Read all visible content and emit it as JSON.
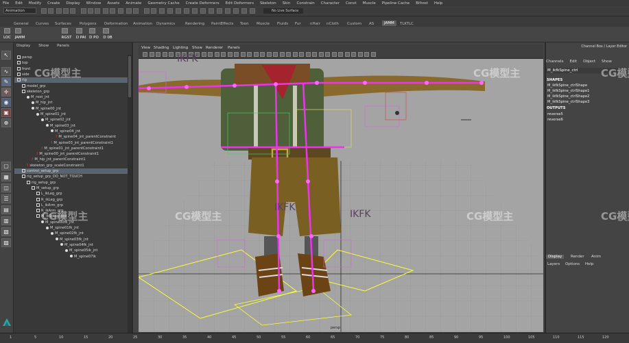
{
  "menubar": [
    "File",
    "Edit",
    "Modify",
    "Create",
    "Display",
    "Window",
    "Assets",
    "Animate",
    "Geometry Cache",
    "Create Deformers",
    "Edit Deformers",
    "Skeleton",
    "Skin",
    "Constrain",
    "Character",
    "Const",
    "Muscle",
    "Pipeline Cache",
    "Bifrost",
    "Help"
  ],
  "status": {
    "mode": "Animation",
    "live_field": "No Live Surface"
  },
  "shelf_tabs": [
    "General",
    "Curves",
    "Surfaces",
    "Polygons",
    "Deformation",
    "Animation",
    "Dynamics",
    "Rendering",
    "PaintEffects",
    "Toon",
    "Muscle",
    "Fluids",
    "Fur",
    "nHair",
    "nCloth",
    "Custom",
    "AS",
    "JAMM",
    "TLKTLC"
  ],
  "shelf_active": "JAMM",
  "shelf_buttons": [
    "LOC",
    "JAMM",
    "RGST",
    "D PAI",
    "D PO",
    "D 0B"
  ],
  "outliner": {
    "menu": [
      "Display",
      "Show",
      "Panels"
    ],
    "rows": [
      {
        "label": "persp",
        "indent": 0,
        "type": "none"
      },
      {
        "label": "top",
        "indent": 0,
        "type": "none"
      },
      {
        "label": "front",
        "indent": 0,
        "type": "none"
      },
      {
        "label": "side",
        "indent": 0,
        "type": "none"
      },
      {
        "label": "rig",
        "indent": 0,
        "type": "grp",
        "sel": true
      },
      {
        "label": "model_grp",
        "indent": 1,
        "type": "grp"
      },
      {
        "label": "skeleton_grp",
        "indent": 1,
        "type": "grp"
      },
      {
        "label": "M_root_jnt",
        "indent": 2,
        "type": "jnt"
      },
      {
        "label": "M_hip_jnt",
        "indent": 3,
        "type": "jnt"
      },
      {
        "label": "M_spine00_jnt",
        "indent": 3,
        "type": "jnt"
      },
      {
        "label": "M_spine01_jnt",
        "indent": 4,
        "type": "jnt"
      },
      {
        "label": "M_spine02_jnt",
        "indent": 5,
        "type": "jnt"
      },
      {
        "label": "M_spine03_jnt",
        "indent": 6,
        "type": "jnt"
      },
      {
        "label": "M_spine04_jnt",
        "indent": 7,
        "type": "jnt"
      },
      {
        "label": "M_spine04_jnt_parentConstraint",
        "indent": 8,
        "type": "con"
      },
      {
        "label": "M_spine03_jnt_parentConstraint1",
        "indent": 7,
        "type": "con"
      },
      {
        "label": "M_spine01_jnt_parentConstraint1",
        "indent": 5,
        "type": "con"
      },
      {
        "label": "M_spine00_jnt_parentConstraint1",
        "indent": 4,
        "type": "con"
      },
      {
        "label": "M_hip_jnt_parentConstraint1",
        "indent": 3,
        "type": "con"
      },
      {
        "label": "skeleton_grp_scaleConstraint1",
        "indent": 2,
        "type": "con"
      },
      {
        "label": "control_setup_grp",
        "indent": 1,
        "type": "grp",
        "sel": true
      },
      {
        "label": "rig_setup_grp_DO_NOT_TOUCH",
        "indent": 1,
        "type": "grp"
      },
      {
        "label": "rig_setup_grp",
        "indent": 2,
        "type": "grp"
      },
      {
        "label": "M_setup_grp",
        "indent": 3,
        "type": "grp"
      },
      {
        "label": "L_ikLeg_grp",
        "indent": 4,
        "type": "grp"
      },
      {
        "label": "R_ikLeg_grp",
        "indent": 4,
        "type": "grp"
      },
      {
        "label": "L_ikArm_grp",
        "indent": 4,
        "type": "grp"
      },
      {
        "label": "R_ikArm_grp",
        "indent": 4,
        "type": "grp"
      },
      {
        "label": "M_ikSpine_grp",
        "indent": 4,
        "type": "grp"
      },
      {
        "label": "M_spine00fk_jnt",
        "indent": 5,
        "type": "jnt"
      },
      {
        "label": "M_spine01fk_jnt",
        "indent": 6,
        "type": "jnt"
      },
      {
        "label": "M_spine02fk_jnt",
        "indent": 7,
        "type": "jnt"
      },
      {
        "label": "M_spine03fk_jnt",
        "indent": 8,
        "type": "jnt"
      },
      {
        "label": "M_spine04fk_jnt",
        "indent": 9,
        "type": "jnt"
      },
      {
        "label": "M_spine05ik_jnt",
        "indent": 10,
        "type": "jnt"
      },
      {
        "label": "M_spine07ik",
        "indent": 11,
        "type": "jnt"
      }
    ]
  },
  "viewport": {
    "menu": [
      "View",
      "Shading",
      "Lighting",
      "Show",
      "Renderer",
      "Panels"
    ],
    "labels": [
      "IKFK",
      "IKFK",
      "IKFK"
    ],
    "camera": "persp"
  },
  "channel_box": {
    "header": "Channel Box / Layer Editor",
    "menu": [
      "Channels",
      "Edit",
      "Object",
      "Show"
    ],
    "node": "M_ikfkSpine_ctrl",
    "shapes_title": "SHAPES",
    "shapes": [
      "M_ikfkSpine_ctrlShape",
      "M_ikfkSpine_ctrlShape1",
      "M_ikfkSpine_ctrlShape2",
      "M_ikfkSpine_ctrlShape3"
    ],
    "outputs_title": "OUTPUTS",
    "outputs": [
      "reverse5",
      "reverse6"
    ],
    "layer_tabs": [
      "Display",
      "Render",
      "Anim"
    ],
    "layer_menu": [
      "Layers",
      "Options",
      "Help"
    ]
  },
  "watermarks": [
    "CG模型主",
    "CG模型主",
    "CG模型主",
    "CG模型主",
    "CG模型主",
    "CG模型主",
    "CG模型主"
  ],
  "timeline_ticks": [
    "1",
    "5",
    "10",
    "15",
    "20",
    "25",
    "30",
    "35",
    "40",
    "45",
    "50",
    "55",
    "60",
    "65",
    "70",
    "75",
    "80",
    "85",
    "90",
    "95",
    "100",
    "105",
    "110",
    "115",
    "120"
  ],
  "colors": {
    "bg": "#444444",
    "viewport": "#a2a2a2",
    "selection": "#5a6470",
    "constraint": "#dd3333",
    "joint": "#ee33ee"
  }
}
